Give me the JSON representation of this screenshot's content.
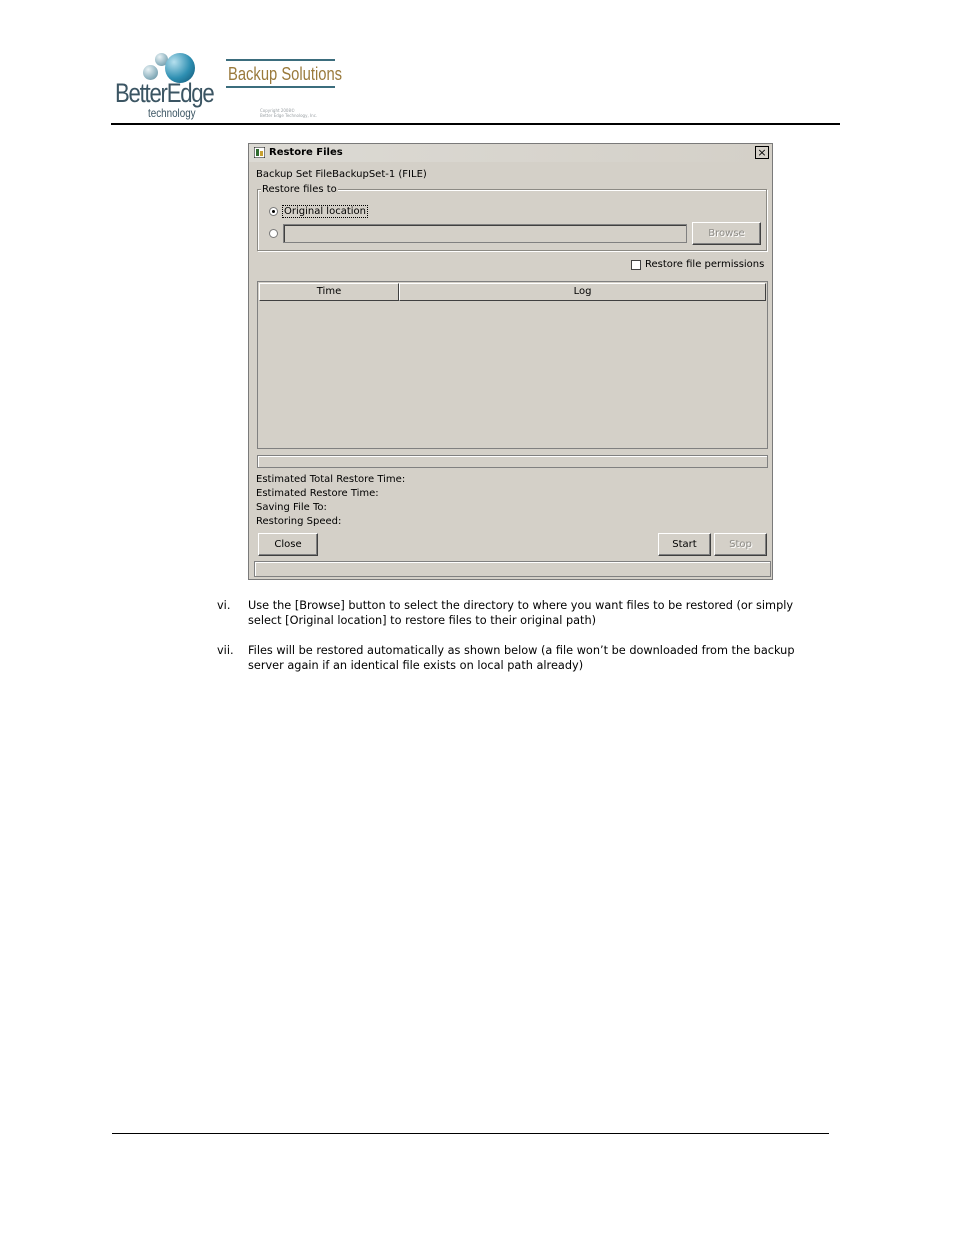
{
  "header": {
    "brand_name": "BetterEdge",
    "brand_sub": "technology",
    "product": "Backup Solutions",
    "copyright_line1": "Copyright 2008©",
    "copyright_line2": "Better Edge Technology, Inc."
  },
  "dialog": {
    "title": "Restore Files",
    "close_glyph": "×",
    "backup_set": "Backup Set FileBackupSet-1 (FILE)",
    "restore_group_label": "Restore files to",
    "option_original": "Original location",
    "option_original_selected": true,
    "custom_path_value": "",
    "browse_label": "Browse",
    "restore_permissions_label": "Restore file permissions",
    "restore_permissions_checked": false,
    "columns": [
      "Time",
      "Log"
    ],
    "log_rows": [],
    "progress": 0,
    "status_labels": {
      "total_time": "Estimated Total Restore Time:",
      "restore_time": "Estimated Restore Time:",
      "saving_to": "Saving File To:",
      "speed": "Restoring Speed:"
    },
    "close_label": "Close",
    "start_label": "Start",
    "stop_label": "Stop"
  },
  "instructions": [
    {
      "number": "vi.",
      "text": "Use the [Browse] button to select the directory to where you want files to be restored (or simply select [Original location] to restore files to their original path)"
    },
    {
      "number": "vii.",
      "text": "Files will be restored automatically as shown below (a file won’t be downloaded from the backup server again if an identical file exists on local path already)"
    }
  ]
}
